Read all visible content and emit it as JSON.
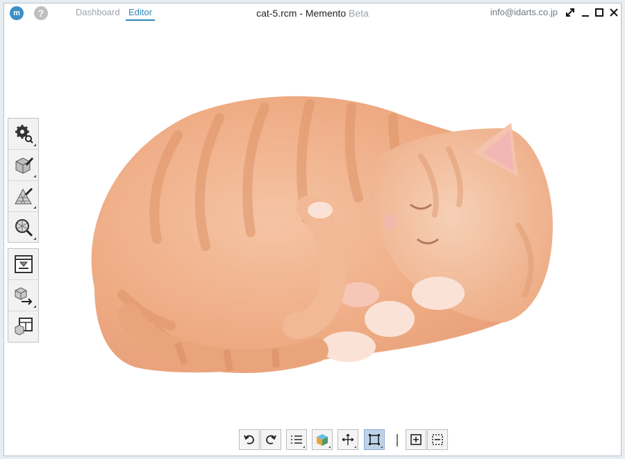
{
  "app": {
    "logo_glyph": "m",
    "help_glyph": "?",
    "title_main": "cat-5.rcm - Memento",
    "title_suffix": "Beta",
    "email": "info@idarts.co.jp"
  },
  "tabs": [
    {
      "label": "Dashboard",
      "active": false
    },
    {
      "label": "Editor",
      "active": true
    }
  ],
  "window_controls": [
    "expand-icon",
    "minimize-icon",
    "maximize-icon",
    "close-icon"
  ],
  "sidebar": {
    "group1": [
      "settings-gear-icon",
      "edit-mesh-icon",
      "paint-pyramid-icon",
      "inspect-sphere-icon"
    ],
    "group2": [
      "import-frame-icon",
      "export-cube-icon",
      "layout-panels-icon"
    ]
  },
  "toolbar": {
    "buttons": [
      "undo-icon",
      "redo-icon",
      "list-icon",
      "color-cube-icon",
      "transform-arrows-icon",
      "selection-square-icon",
      "add-box-icon",
      "dotted-select-icon"
    ],
    "active": "selection-square-icon"
  },
  "colors": {
    "accent": "#2f86b8",
    "cat_orange": "#f0b08a",
    "cat_stripe": "#de9468",
    "active_button": "#bcd3ea"
  }
}
